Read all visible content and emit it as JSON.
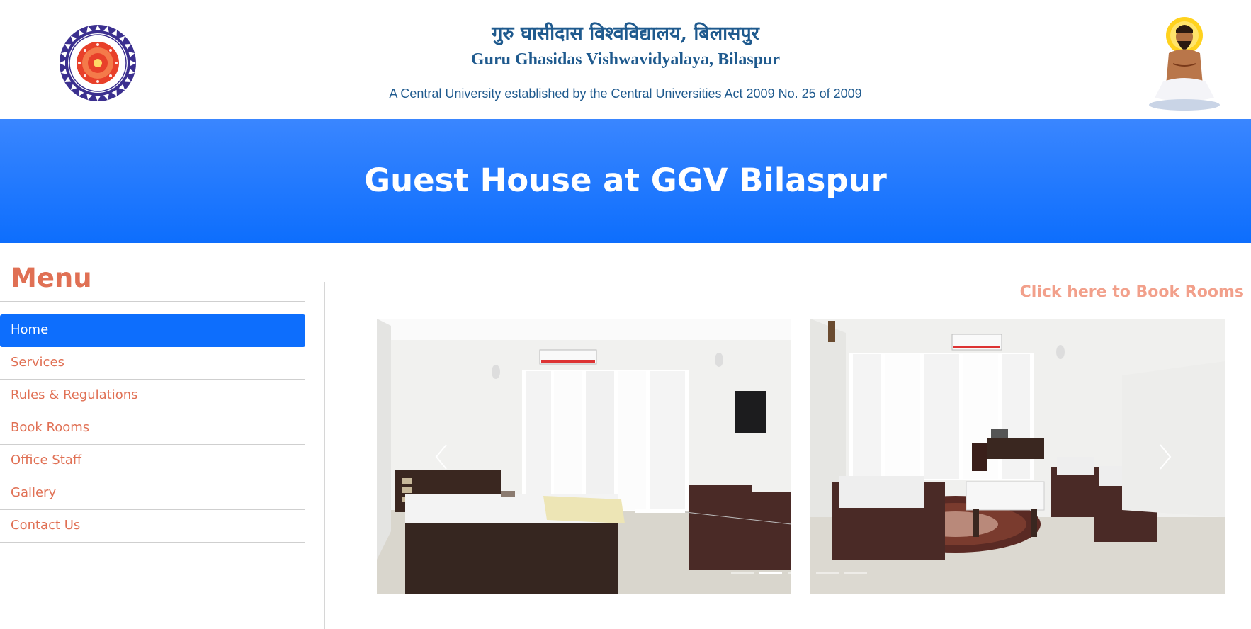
{
  "header": {
    "hindi_name": "गुरु घासीदास विश्वविद्यालय, बिलासपुर",
    "english_name": "Guru Ghasidas Vishwavidyalaya, Bilaspur",
    "act_line": "A Central University established by the Central Universities Act 2009 No. 25 of 2009",
    "logo_icon": "university-seal-icon",
    "saint_icon": "guru-ghasidas-portrait-icon"
  },
  "banner": {
    "title": "Guest House at GGV Bilaspur"
  },
  "sidebar": {
    "heading": "Menu",
    "items": [
      {
        "label": "Home",
        "active": true
      },
      {
        "label": "Services",
        "active": false
      },
      {
        "label": "Rules & Regulations",
        "active": false
      },
      {
        "label": "Book Rooms",
        "active": false
      },
      {
        "label": "Office Staff",
        "active": false
      },
      {
        "label": "Gallery",
        "active": false
      },
      {
        "label": "Contact Us",
        "active": false
      }
    ]
  },
  "main": {
    "book_link": "Click here to Book Rooms",
    "carousel": {
      "slides": [
        "bedroom-photo",
        "sitting-room-photo"
      ],
      "indicator_count": 5,
      "active_indicator": 2
    }
  },
  "colors": {
    "brand_blue": "#0d6efd",
    "header_text": "#1f5a8e",
    "accent_orange": "#e07054",
    "link_light": "#f2a08b"
  }
}
